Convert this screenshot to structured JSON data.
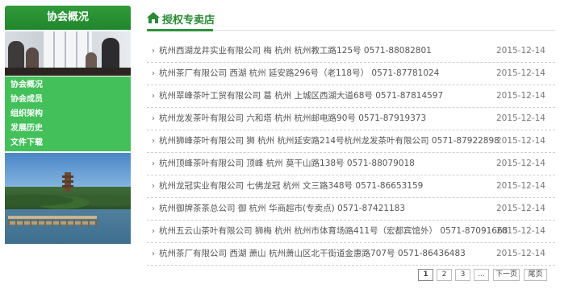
{
  "sidebar": {
    "title": "协会概况",
    "menu": [
      "协会概况",
      "协会成员",
      "组织架构",
      "发展历史",
      "文件下载"
    ]
  },
  "main": {
    "title": "授权专卖店",
    "home_icon": "home-icon"
  },
  "rows": [
    {
      "title": "杭州西湖龙井实业有限公司 梅 杭州 杭州教工路125号 0571-88082801",
      "date": "2015-12-14"
    },
    {
      "title": "杭州茶厂有限公司 西湖 杭州 延安路296号（老118号） 0571-87781024",
      "date": "2015-12-14"
    },
    {
      "title": "杭州翠峰茶叶工贸有限公司 葛 杭州 上城区西湖大道68号 0571-87814597",
      "date": "2015-12-14"
    },
    {
      "title": "杭州龙发茶叶有限公司 六和塔 杭州 杭州邮电路90号 0571-87919373",
      "date": "2015-12-14"
    },
    {
      "title": "杭州狮峰茶叶有限公司 狮 杭州 杭州延安路214号杭州龙发茶叶有限公司 0571-87922898",
      "date": "2015-12-14"
    },
    {
      "title": "杭州顶峰茶叶有限公司 顶峰 杭州 莫干山路138号 0571-88079018",
      "date": "2015-12-14"
    },
    {
      "title": "杭州龙冠实业有限公司 七佛龙冠 杭州 文三路348号 0571-86653159",
      "date": "2015-12-14"
    },
    {
      "title": "杭州御牌茶茶总公司 御 杭州 华商超市(专卖点) 0571-87421183",
      "date": "2015-12-14"
    },
    {
      "title": "杭州五云山茶叶有限公司 狮梅 杭州 杭州市体育场路411号（宏都宾馆外） 0571-87091668",
      "date": "2015-12-14"
    },
    {
      "title": "杭州茶厂有限公司 西湖 萧山 杭州萧山区北干街道金惠路707号 0571-86436483",
      "date": "2015-12-14"
    }
  ],
  "pager": {
    "pages": [
      "1",
      "2",
      "3",
      "..."
    ],
    "current": "1",
    "next": "下一页",
    "last": "尾页"
  },
  "colors": {
    "brand_green": "#2a9438",
    "menu_green": "#43c05a"
  }
}
